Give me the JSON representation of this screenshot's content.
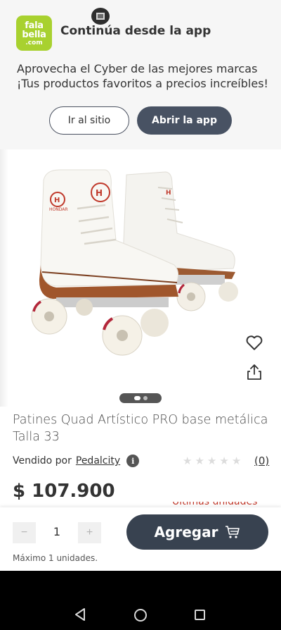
{
  "banner": {
    "logo": {
      "line1": "fala",
      "line2": "bella",
      "line3": ".com",
      "color": "#a8d12f"
    },
    "title": "Continúa desde la app",
    "promo_line1": "Aprovecha el Cyber de las mejores marcas",
    "promo_line2": "¡Tus productos favoritos a precios increíbles!",
    "site_button": "Ir al sitio",
    "app_button": "Abrir la app"
  },
  "product": {
    "image_alt": "Patines Quad Artístico PRO base metálica",
    "image_brand_text": "HONDAR",
    "title": "Patines Quad Artístico PRO base metálica Talla 33",
    "seller_label": "Vendido por",
    "seller_name": "Pedalcity",
    "rating": {
      "stars_filled": 0,
      "stars_total": 5,
      "review_count": "(0)"
    },
    "price": "$ 107.900",
    "gallery": {
      "current": 1,
      "total": 2
    }
  },
  "cart": {
    "quantity": "1",
    "minus_label": "−",
    "plus_label": "+",
    "max_note": "Máximo 1 unidades.",
    "add_button": "Agregar"
  },
  "icons": {
    "favorite": "heart-icon",
    "share": "share-icon",
    "cart": "shopping-cart-icon",
    "info": "info-icon"
  },
  "colors": {
    "brand_green": "#a8d12f",
    "primary_button": "#384250",
    "secondary_button": "#485263"
  }
}
